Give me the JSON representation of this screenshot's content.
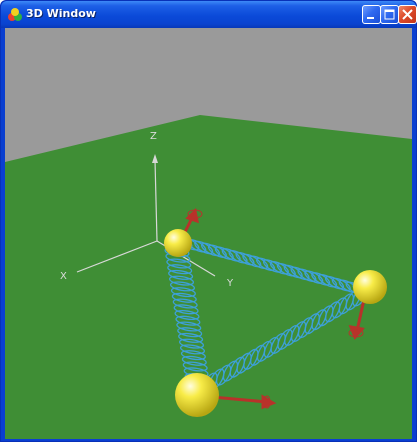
{
  "window": {
    "title": "3D Window",
    "icon": "3d-app-icon",
    "buttons": [
      "minimize-icon",
      "maximize-icon",
      "close-icon"
    ]
  },
  "scene": {
    "axes": {
      "x": "X",
      "y": "Y",
      "z": "Z"
    },
    "colors": {
      "background": "#9a9a9a",
      "ground": "#3f8e35",
      "sphere": "#f4e63a",
      "spring": "#3da0d8",
      "arrow": "#b8322a"
    }
  }
}
